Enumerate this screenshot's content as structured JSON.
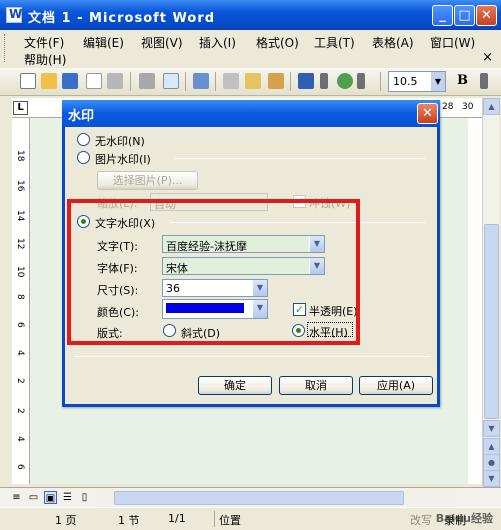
{
  "window": {
    "title": "文档 1 - Microsoft Word"
  },
  "menu": {
    "items": [
      "文件(F)",
      "编辑(E)",
      "视图(V)",
      "插入(I)",
      "格式(O)",
      "工具(T)",
      "表格(A)",
      "窗口(W)",
      "帮助(H)"
    ],
    "close_glyph": "×"
  },
  "toolbar": {
    "font_size": "10.5",
    "bold_label": "B"
  },
  "ruler": {
    "h_ticks": [
      "28",
      "30"
    ],
    "v_ticks": [
      "18",
      "16",
      "14",
      "12",
      "10",
      "8",
      "6",
      "4",
      "2",
      "2",
      "4",
      "6"
    ]
  },
  "statusbar": {
    "page": "1 页",
    "section": "1 节",
    "page_of": "1/1",
    "position": "位置",
    "ovr": "改写",
    "rec": "录制",
    "ext": "扩展"
  },
  "dialog": {
    "title": "水印",
    "no_watermark": "无水印(N)",
    "picture_watermark": "图片水印(I)",
    "select_picture": "选择图片(P)...",
    "scale_label": "缩放(L):",
    "scale_value": "自动",
    "washout_label": "冲蚀(W)",
    "text_watermark": "文字水印(X)",
    "text_label": "文字(T):",
    "text_value": "百度经验-沫抚摩",
    "font_label": "字体(F):",
    "font_value": "宋体",
    "size_label": "尺寸(S):",
    "size_value": "36",
    "color_label": "颜色(C):",
    "color_value": "#0000e0",
    "semitransparent_label": "半透明(E)",
    "layout_label": "版式:",
    "diagonal_label": "斜式(D)",
    "horizontal_label": "水平(H)",
    "ok": "确定",
    "cancel": "取消",
    "apply": "应用(A)"
  },
  "overlay": {
    "watermark_text": "Baidu经验"
  }
}
